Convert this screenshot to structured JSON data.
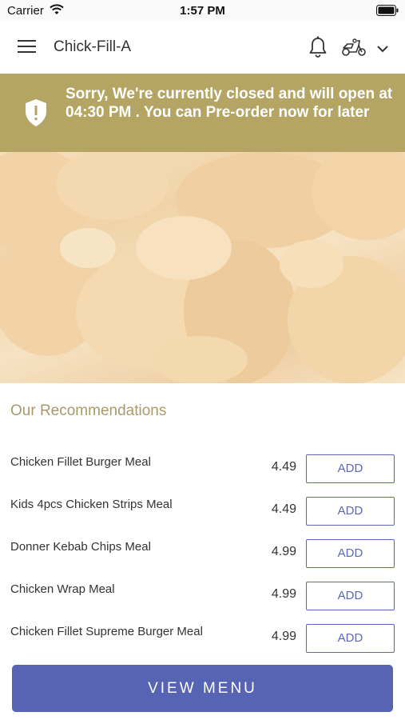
{
  "status_bar": {
    "carrier": "Carrier",
    "time": "1:57 PM"
  },
  "header": {
    "title": "Chick-Fill-A",
    "icons": [
      "menu-icon",
      "bell-icon",
      "scooter-icon",
      "chevron-down-icon"
    ]
  },
  "banner": {
    "text": "Sorry, We're currently closed and will open at 04:30 PM . You can Pre-order now for later",
    "icon": "shield-icon",
    "color": "#b5a564"
  },
  "recommendations": {
    "title": "Our Recommendations",
    "add_label": "ADD",
    "items": [
      {
        "name": "Chicken Fillet Burger Meal",
        "price": "4.49"
      },
      {
        "name": "Kids 4pcs Chicken Strips Meal",
        "price": "4.49"
      },
      {
        "name": "Donner Kebab Chips Meal",
        "price": "4.99"
      },
      {
        "name": "Chicken Wrap Meal",
        "price": "4.99"
      },
      {
        "name": "Chicken Fillet Supreme Burger Meal",
        "price": "4.99"
      }
    ]
  },
  "view_menu_label": "VIEW MENU",
  "colors": {
    "accent": "#5763b3",
    "banner": "#b5a564",
    "section_title": "#a89a6c"
  }
}
